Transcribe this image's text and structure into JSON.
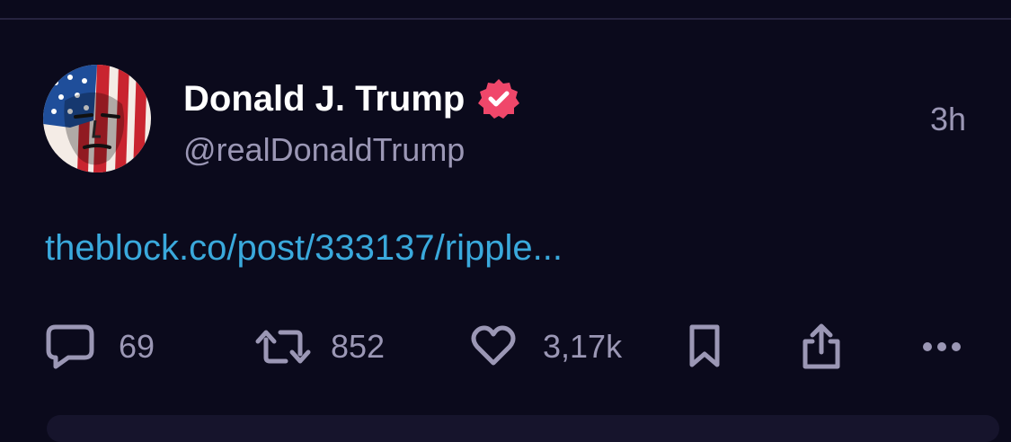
{
  "post": {
    "author": {
      "display_name": "Donald J. Trump",
      "handle": "@realDonaldTrump",
      "verified": true,
      "verified_badge_color": "#f0476a"
    },
    "timestamp": "3h",
    "link_text": "theblock.co/post/333137/ripple...",
    "link_color": "#3aa9dc"
  },
  "actions": {
    "reply": {
      "icon": "reply-icon",
      "count": "69"
    },
    "repost": {
      "icon": "repost-icon",
      "count": "852"
    },
    "like": {
      "icon": "heart-icon",
      "count": "3,17k"
    },
    "bookmark": {
      "icon": "bookmark-icon"
    },
    "share": {
      "icon": "share-icon"
    },
    "more": {
      "icon": "more-icon"
    }
  },
  "theme": {
    "background": "#0b0a1c",
    "muted_text": "#9b97b5"
  }
}
